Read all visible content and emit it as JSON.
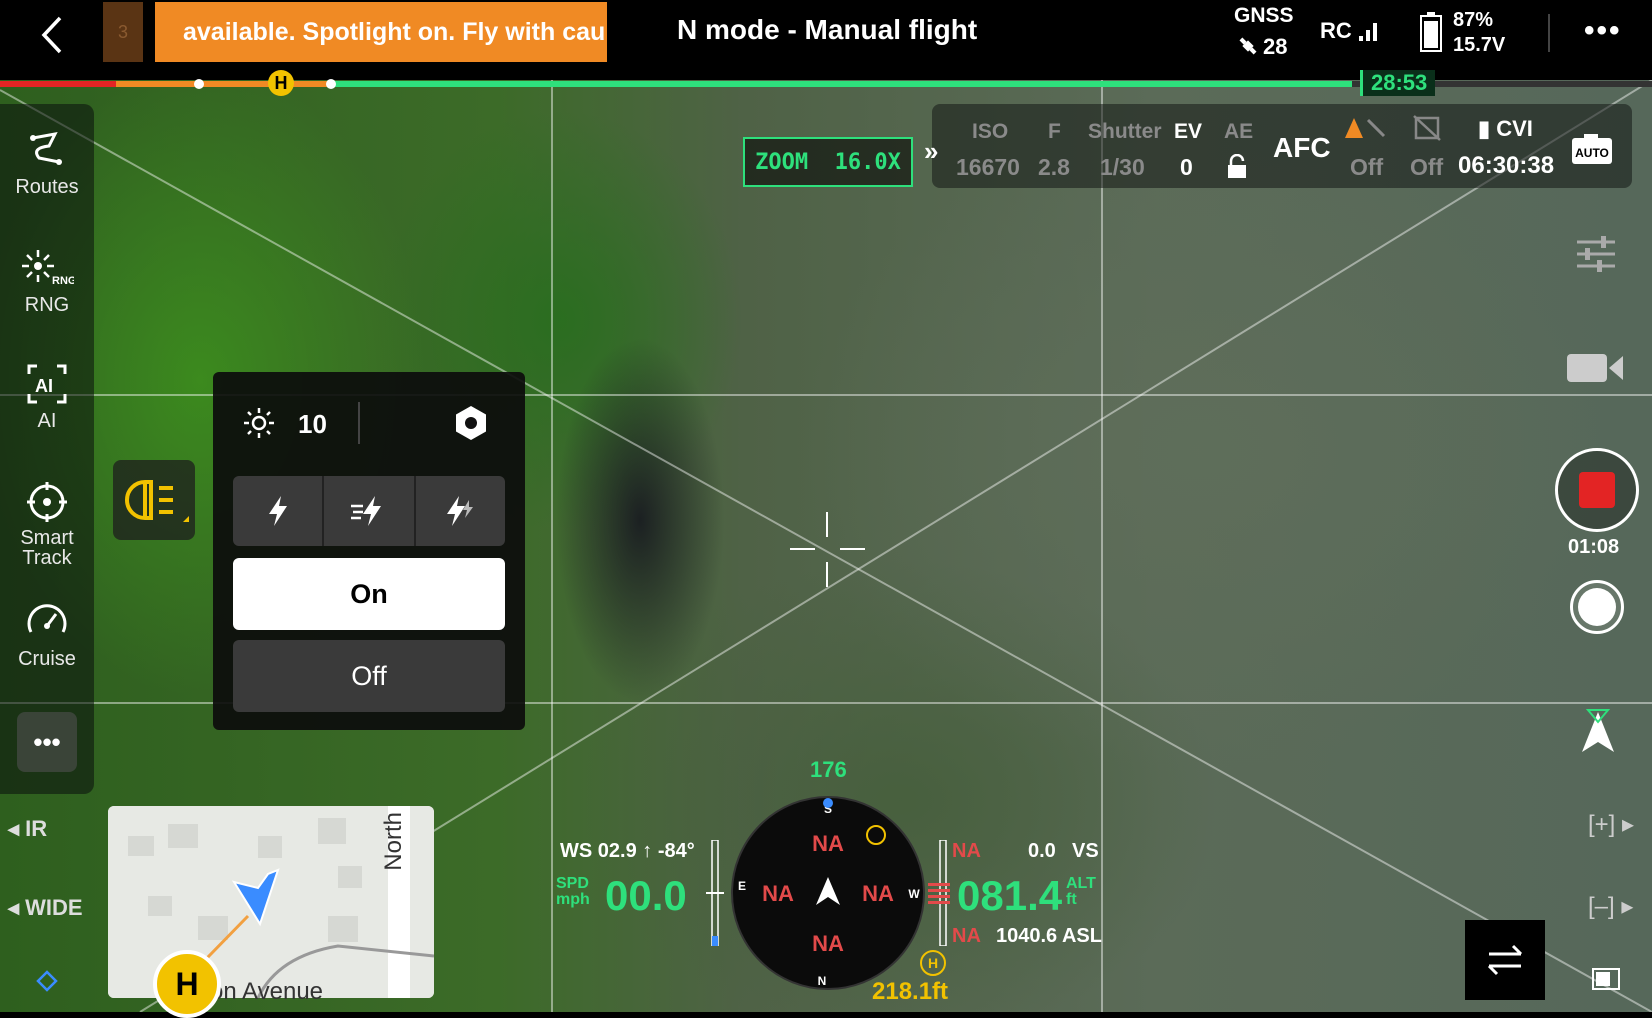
{
  "topbar": {
    "warning_count": "3",
    "warning_text": "available. Spotlight on. Fly with cau",
    "flight_mode": "N mode - Manual flight",
    "gnss_label": "GNSS",
    "gnss_count": "28",
    "rc_label": "RC",
    "battery_percent": "87%",
    "battery_voltage": "15.7V",
    "more": "•••"
  },
  "timeline": {
    "time_remaining": "28:53",
    "home_marker": "H",
    "colors": {
      "used": "#e32424",
      "return": "#f08a24",
      "available": "#2ee07c"
    }
  },
  "sidebar": {
    "items": [
      {
        "label": "Routes",
        "icon": "routes-icon"
      },
      {
        "label": "RNG",
        "icon": "rng-icon",
        "badge": "RNG"
      },
      {
        "label": "AI",
        "icon": "ai-icon",
        "badge": "AI"
      },
      {
        "label": "Smart\nTrack",
        "icon": "smart-track-icon"
      },
      {
        "label": "Cruise",
        "icon": "cruise-icon"
      }
    ],
    "more": "•••",
    "lens_ir": "IR",
    "lens_wide": "WIDE"
  },
  "spotlight_panel": {
    "brightness": "10",
    "modes": [
      "flash-icon",
      "flash-sweep-icon",
      "flash-strobe-icon"
    ],
    "on_label": "On",
    "off_label": "Off",
    "selected": "On"
  },
  "camera": {
    "zoom": "ZOOM  16.0X",
    "iso_label": "ISO",
    "iso_value": "16670",
    "f_label": "F",
    "f_value": "2.8",
    "shutter_label": "Shutter",
    "shutter_value": "1/30",
    "ev_label": "EV",
    "ev_value": "0",
    "ae_label": "AE",
    "focus_mode": "AFC",
    "obstacle_1": "Off",
    "obstacle_2": "Off",
    "storage_label": "CVI",
    "storage_time": "06:30:38",
    "auto_badge": "AUTO"
  },
  "recording": {
    "record_time": "01:08"
  },
  "map": {
    "north_label": "North",
    "street_label": "gton Avenue",
    "home_label": "H"
  },
  "telemetry": {
    "wind": "WS 02.9 ↑ -84°",
    "speed_label": "SPD\nmph",
    "speed": "00.0",
    "heading": "176",
    "compass": {
      "n": "N",
      "s": "S",
      "e": "E",
      "w": "W",
      "na": "NA"
    },
    "altitude": "081.4",
    "alt_label": "ALT\nft",
    "vs_na": "NA",
    "vs_value": "0.0",
    "vs_label": "VS",
    "asl_na": "NA",
    "asl": "1040.6 ASL",
    "home_distance": "218.1ft"
  }
}
